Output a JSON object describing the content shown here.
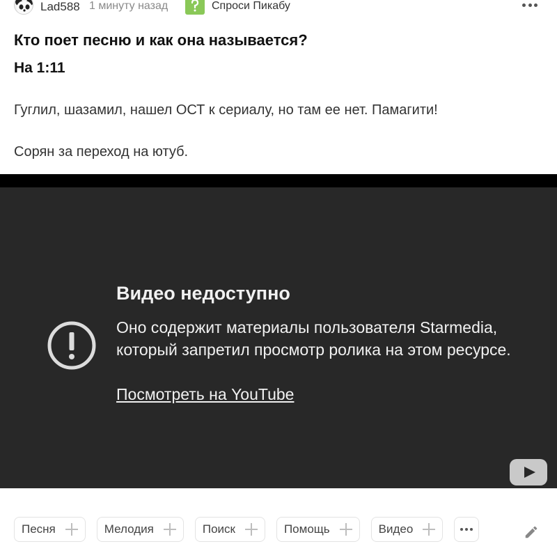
{
  "post": {
    "author": "Lad588",
    "time": "1 минуту назад",
    "community": "Спроси Пикабу",
    "title": "Кто поет песню и как она называется?",
    "subtitle": "На 1:11",
    "paragraphs": [
      "Гуглил, шазамил, нашел ОСТ к сериалу, но там ее нет. Памагити!",
      "Сорян за переход на ютуб."
    ]
  },
  "video": {
    "error_title": "Видео недоступно",
    "error_text": "Оно содержит материалы пользователя Starmedia, который запретил просмотр ролика на этом ресурсе.",
    "link": "Посмотреть на YouTube"
  },
  "tags": [
    "Песня",
    "Мелодия",
    "Поиск",
    "Помощь",
    "Видео"
  ],
  "icons": {
    "avatar": "panda-avatar",
    "community": "question-mark-icon",
    "error": "exclamation-circle-icon",
    "youtube": "youtube-logo-icon",
    "edit": "pencil-icon",
    "more": "ellipsis-icon"
  },
  "colors": {
    "video_bg": "#282828",
    "community_green": "#8ac858"
  }
}
